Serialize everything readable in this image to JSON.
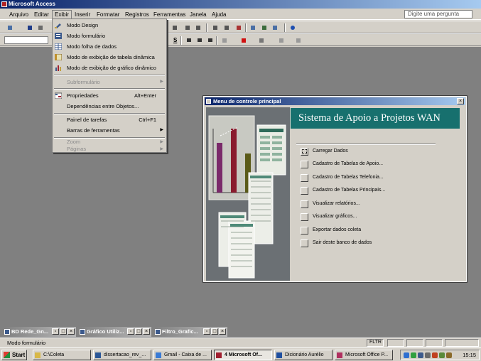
{
  "app": {
    "title": "Microsoft Access"
  },
  "menubar": {
    "items": [
      "Arquivo",
      "Editar",
      "Exibir",
      "Inserir",
      "Formatar",
      "Registros",
      "Ferramentas",
      "Janela",
      "Ajuda"
    ],
    "ask_placeholder": "Digite uma pergunta"
  },
  "toolbar": {
    "underline_label": "S"
  },
  "view_menu": {
    "items": [
      {
        "label": "Modo Design",
        "icon": "design-view-icon"
      },
      {
        "label": "Modo formulário",
        "icon": "form-view-icon"
      },
      {
        "label": "Modo folha de dados",
        "icon": "datasheet-view-icon"
      },
      {
        "label": "Modo de exibição de tabela dinâmica",
        "icon": "pivot-table-icon"
      },
      {
        "label": "Modo de exibição de gráfico dinâmico",
        "icon": "pivot-chart-icon"
      },
      {
        "label": "Subformulário",
        "icon": "",
        "disabled": true,
        "submenu": true
      },
      {
        "label": "Propriedades",
        "icon": "properties-icon",
        "shortcut": "Alt+Enter"
      },
      {
        "label": "Dependências entre Objetos...",
        "icon": ""
      },
      {
        "label": "Painel de tarefas",
        "icon": "",
        "shortcut": "Ctrl+F1"
      },
      {
        "label": "Barras de ferramentas",
        "icon": "",
        "submenu": true
      },
      {
        "label": "Zoom",
        "icon": "",
        "disabled": true,
        "submenu": true
      },
      {
        "label": "Páginas",
        "icon": "",
        "disabled": true,
        "submenu": true
      }
    ]
  },
  "switchboard": {
    "title": "Menu de controle principal",
    "banner": "Sistema de Apoio a Projetos WAN",
    "options": [
      "Carregar Dados",
      "Cadastro de Tabelas de Apoio...",
      "Cadastro de Tabelas Telefonia...",
      "Cadastro de Tabelas Principais...",
      "Visualizar relatórios...",
      "Visualizar gráficos...",
      "Exportar dados coleta",
      "Sair deste banco de dados"
    ]
  },
  "minimized_windows": [
    "BD Rede_Gn...",
    "Gráfico Utiliz...",
    "Filtro_Grafic..."
  ],
  "status": {
    "text": "Modo formulário",
    "filter": "FLTR"
  },
  "taskbar": {
    "start_label": "Start",
    "tasks": [
      {
        "label": "C:\\Coleta",
        "active": false
      },
      {
        "label": "dissertacao_rev_...",
        "active": false
      },
      {
        "label": "Gmail - Caixa de ...",
        "active": false
      },
      {
        "label": "4 Microsoft Of...",
        "active": true
      },
      {
        "label": "Dicionário Aurélio",
        "active": false
      },
      {
        "label": "Microsoft Office P...",
        "active": false
      }
    ],
    "clock": "15:15"
  },
  "colors": {
    "title_active": "#0a246a",
    "banner": "#17706e",
    "mdi_background": "#808080"
  }
}
